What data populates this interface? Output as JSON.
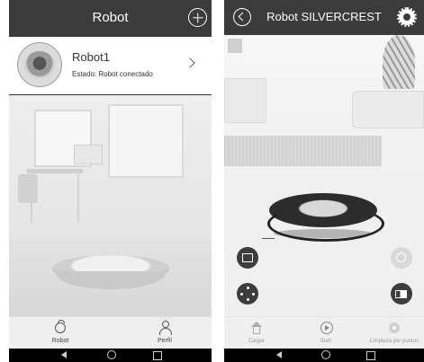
{
  "left_screen": {
    "header": {
      "title": "Robot"
    },
    "robot": {
      "name": "Robot1",
      "status": "Estado: Robot conectado"
    },
    "tabs": [
      {
        "label": "Robot",
        "icon": "robot-icon"
      },
      {
        "label": "Perfil",
        "icon": "person-icon"
      }
    ]
  },
  "right_screen": {
    "header": {
      "title": "Robot SILVERCREST"
    },
    "actions": [
      {
        "label": "Cargar",
        "icon": "house-icon"
      },
      {
        "label": "Start",
        "icon": "play-icon"
      },
      {
        "label": "Limpieza por puntos",
        "icon": "spot-icon"
      }
    ]
  },
  "colors": {
    "header_bg": "#3b3b3b",
    "button_dark": "#3d3d3d",
    "button_disabled": "#d9d9d9",
    "navbar_bg": "#000000"
  }
}
